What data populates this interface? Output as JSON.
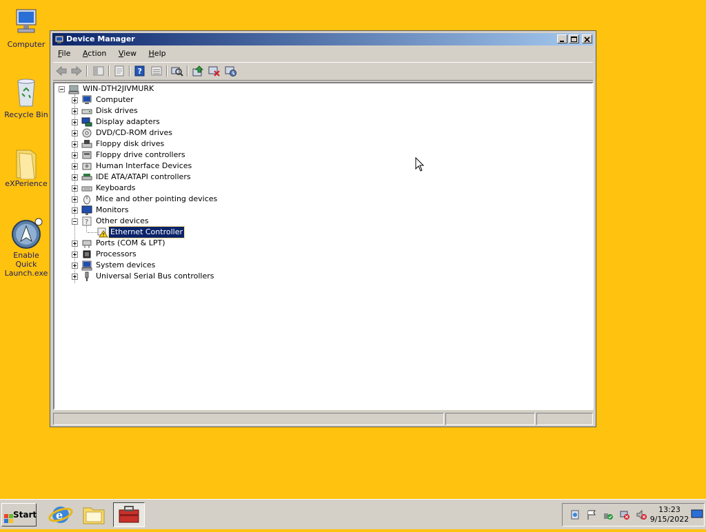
{
  "desktop": {
    "icons": [
      {
        "label": "Computer",
        "icon": "computer-icon"
      },
      {
        "label": "Recycle Bin",
        "icon": "recycle-bin-icon"
      },
      {
        "label": "eXPerience",
        "icon": "folder-icon"
      },
      {
        "label": "Enable Quick\nLaunch.exe",
        "icon": "quick-launch-icon"
      }
    ],
    "background_color": "#FFC20E"
  },
  "window": {
    "title": "Device Manager",
    "menus": [
      {
        "label": "File",
        "accel": "F"
      },
      {
        "label": "Action",
        "accel": "A"
      },
      {
        "label": "View",
        "accel": "V"
      },
      {
        "label": "Help",
        "accel": "H"
      }
    ],
    "toolbar_icons": [
      "back-icon",
      "forward-icon",
      "show-hide-console-tree-icon",
      "properties-icon",
      "help-icon",
      "details-icon",
      "scan-hardware-icon",
      "update-driver-icon",
      "uninstall-icon",
      "disable-icon"
    ],
    "tree": {
      "root": "WIN-DTH2JIVMURK",
      "categories": [
        {
          "label": "Computer",
          "icon": "computer-icon",
          "expanded": false
        },
        {
          "label": "Disk drives",
          "icon": "disk-drive-icon",
          "expanded": false
        },
        {
          "label": "Display adapters",
          "icon": "display-adapter-icon",
          "expanded": false
        },
        {
          "label": "DVD/CD-ROM drives",
          "icon": "dvd-drive-icon",
          "expanded": false
        },
        {
          "label": "Floppy disk drives",
          "icon": "floppy-drive-icon",
          "expanded": false
        },
        {
          "label": "Floppy drive controllers",
          "icon": "floppy-controller-icon",
          "expanded": false
        },
        {
          "label": "Human Interface Devices",
          "icon": "hid-icon",
          "expanded": false
        },
        {
          "label": "IDE ATA/ATAPI controllers",
          "icon": "ide-controller-icon",
          "expanded": false
        },
        {
          "label": "Keyboards",
          "icon": "keyboard-icon",
          "expanded": false
        },
        {
          "label": "Mice and other pointing devices",
          "icon": "mouse-icon",
          "expanded": false
        },
        {
          "label": "Monitors",
          "icon": "monitor-icon",
          "expanded": false
        },
        {
          "label": "Other devices",
          "icon": "unknown-device-icon",
          "expanded": true,
          "children": [
            {
              "label": "Ethernet Controller",
              "icon": "warning-device-icon",
              "selected": true
            }
          ]
        },
        {
          "label": "Ports (COM & LPT)",
          "icon": "port-icon",
          "expanded": false
        },
        {
          "label": "Processors",
          "icon": "processor-icon",
          "expanded": false
        },
        {
          "label": "System devices",
          "icon": "system-device-icon",
          "expanded": false
        },
        {
          "label": "Universal Serial Bus controllers",
          "icon": "usb-icon",
          "expanded": false
        }
      ]
    }
  },
  "taskbar": {
    "start_label": "Start",
    "quick_launch": [
      "internet-explorer-icon",
      "explorer-icon",
      "toolbox-icon"
    ],
    "tray_icons": [
      "server-manager-icon",
      "flag-icon",
      "network-ok-icon",
      "network-disconnected-icon",
      "volume-muted-icon"
    ],
    "clock_time": "13:23",
    "clock_date": "9/15/2022"
  }
}
